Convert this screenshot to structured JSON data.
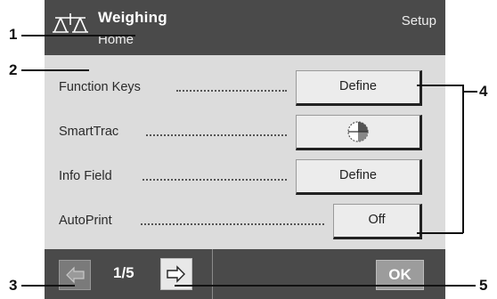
{
  "header": {
    "title": "Weighing",
    "subtitle": "Home",
    "setup_label": "Setup",
    "icon": "balance-scale-icon"
  },
  "rows": [
    {
      "label": "Function Keys",
      "button": "Define"
    },
    {
      "label": "SmartTrac",
      "button_icon": "smarttrac-icon"
    },
    {
      "label": "Info Field",
      "button": "Define"
    },
    {
      "label": "AutoPrint",
      "button": "Off"
    }
  ],
  "footer": {
    "prev_icon": "arrow-left-icon",
    "page": "1/5",
    "next_icon": "arrow-right-icon",
    "ok_label": "OK"
  },
  "callouts": [
    "1",
    "2",
    "3",
    "4",
    "5"
  ],
  "colors": {
    "header_bg": "#4a4a4a",
    "content_bg": "#dcdcdc",
    "button_bg": "#ececec"
  }
}
